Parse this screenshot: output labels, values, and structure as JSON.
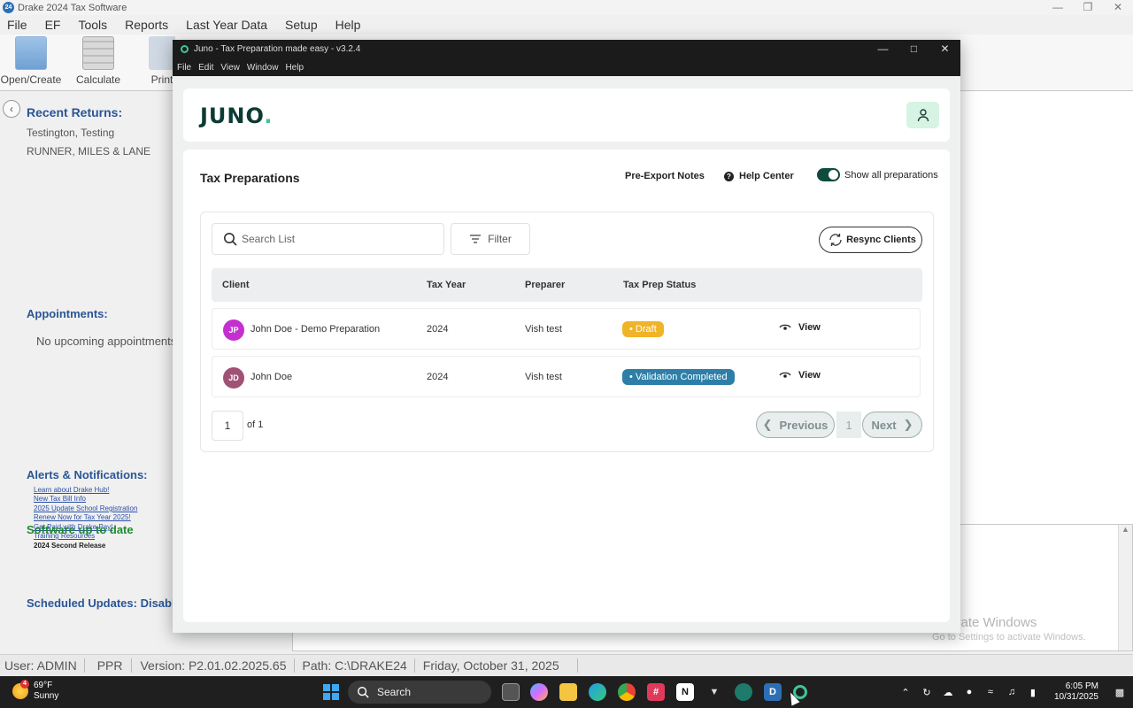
{
  "drake": {
    "title": "Drake 2024 Tax Software",
    "app_badge": "24",
    "menu": [
      "File",
      "EF",
      "Tools",
      "Reports",
      "Last Year Data",
      "Setup",
      "Help"
    ],
    "toolbar": {
      "open_create": "Open/Create",
      "calculate": "Calculate",
      "print": "Print"
    },
    "recent_returns": {
      "title": "Recent Returns:",
      "items": [
        "Testington, Testing",
        "RUNNER, MILES & LANE"
      ]
    },
    "appointments": {
      "title": "Appointments:",
      "empty": "No upcoming appointments"
    },
    "alerts": {
      "title": "Alerts & Notifications:",
      "links": [
        "Learn about Drake Hub!",
        "New Tax Bill Info",
        "2025 Update School Registration",
        "Renew Now for Tax Year 2025!",
        "Get Paid with Drake Pay!",
        "Training Resources"
      ],
      "bold": "2024 Second Release"
    },
    "scheduled_updates": "Scheduled Updates: Disabled",
    "software_status": "Software up to date",
    "status_bar": [
      "User: ADMIN",
      "PPR",
      "Version: P2.01.02.2025.65",
      "Path: C:\\DRAKE24",
      "Friday, October 31, 2025"
    ],
    "watermark": {
      "title": "Activate Windows",
      "subtitle": "Go to Settings to activate Windows."
    }
  },
  "juno": {
    "window_title": "Juno - Tax Preparation made easy - v3.2.4",
    "menu": [
      "File",
      "Edit",
      "View",
      "Window",
      "Help"
    ],
    "logo": "JUNO",
    "page_title": "Tax Preparations",
    "pre_export_notes": "Pre-Export Notes",
    "help_center": "Help Center",
    "show_all": "Show all preparations",
    "search_placeholder": "Search List",
    "filter_label": "Filter",
    "resync_label": "Resync Clients",
    "columns": [
      "Client",
      "Tax Year",
      "Preparer",
      "Tax Prep Status"
    ],
    "rows": [
      {
        "initials": "JP",
        "avatar_color": "#c42fd0",
        "client": "John Doe - Demo Preparation",
        "tax_year": "2024",
        "preparer": "Vish test",
        "status": "• Draft",
        "status_color": "#f0b428",
        "action": "View"
      },
      {
        "initials": "JD",
        "avatar_color": "#a05275",
        "client": "John Doe",
        "tax_year": "2024",
        "preparer": "Vish test",
        "status": "• Validation Completed",
        "status_color": "#2d7fa8",
        "action": "View"
      }
    ],
    "pagination": {
      "current_page_input": "1",
      "of_label": "of 1",
      "previous": "Previous",
      "page": "1",
      "next": "Next"
    }
  },
  "taskbar": {
    "weather": {
      "temp": "69°F",
      "condition": "Sunny",
      "badge": "4"
    },
    "search": "Search",
    "time": "6:05 PM",
    "date": "10/31/2025"
  }
}
